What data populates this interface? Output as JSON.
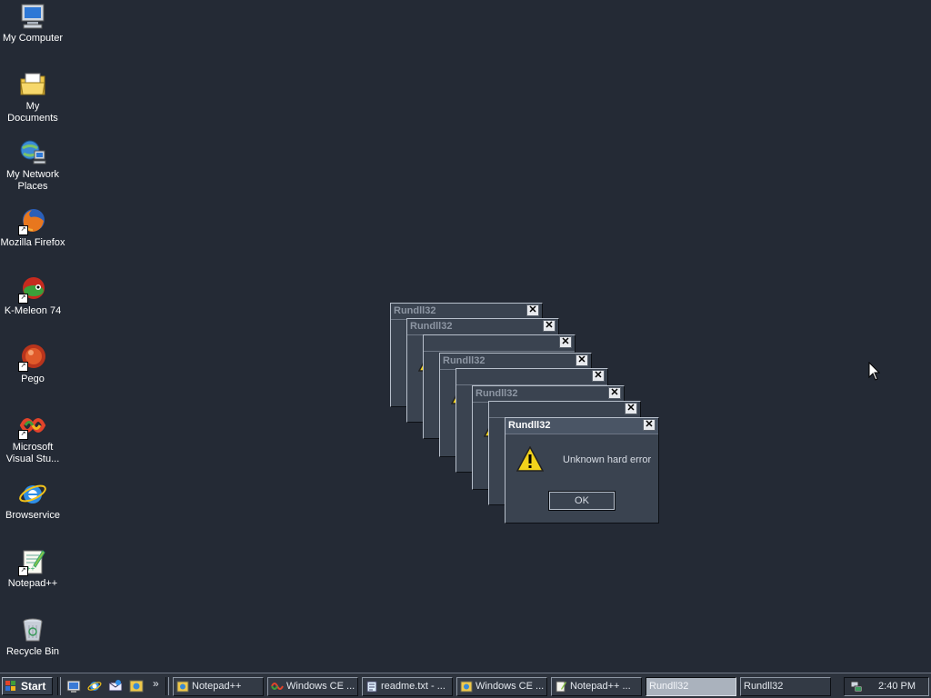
{
  "desktop": {
    "icons": [
      {
        "label": "My Computer",
        "icon": "computer-icon"
      },
      {
        "label": "My Documents",
        "icon": "folder-documents-icon"
      },
      {
        "label": "My Network Places",
        "icon": "network-places-icon"
      },
      {
        "label": "Mozilla Firefox",
        "icon": "firefox-icon"
      },
      {
        "label": "K-Meleon 74",
        "icon": "kmeleon-icon"
      },
      {
        "label": "Pego",
        "icon": "pego-icon"
      },
      {
        "label": "Microsoft Visual Stu...",
        "icon": "visual-studio-icon"
      },
      {
        "label": "Browservice",
        "icon": "internet-explorer-icon"
      },
      {
        "label": "Notepad++",
        "icon": "notepadpp-icon"
      },
      {
        "label": "Recycle Bin",
        "icon": "recycle-bin-icon"
      }
    ]
  },
  "dialogs": {
    "title": "Rundll32",
    "close": "✕",
    "message": "Unknown hard error",
    "ok_label": "OK"
  },
  "taskbar": {
    "start_label": "Start",
    "quicklaunch_more": "»",
    "buttons": [
      {
        "label": "Notepad++",
        "icon": "notepadpp-icon"
      },
      {
        "label": "Windows CE ...",
        "icon": "windows-ce-icon"
      },
      {
        "label": "readme.txt - ...",
        "icon": "notepad-icon"
      },
      {
        "label": "Windows CE ...",
        "icon": "windows-ce-icon"
      },
      {
        "label": "Notepad++ ...",
        "icon": "notepadpp-icon"
      },
      {
        "label": "Rundll32",
        "icon": ""
      },
      {
        "label": "Rundll32",
        "icon": ""
      }
    ],
    "clock": "2:40 PM"
  },
  "colors": {
    "desktop_bg": "#242a35",
    "dialog_bg": "#3a4350",
    "warning_yellow": "#f2d21b"
  }
}
